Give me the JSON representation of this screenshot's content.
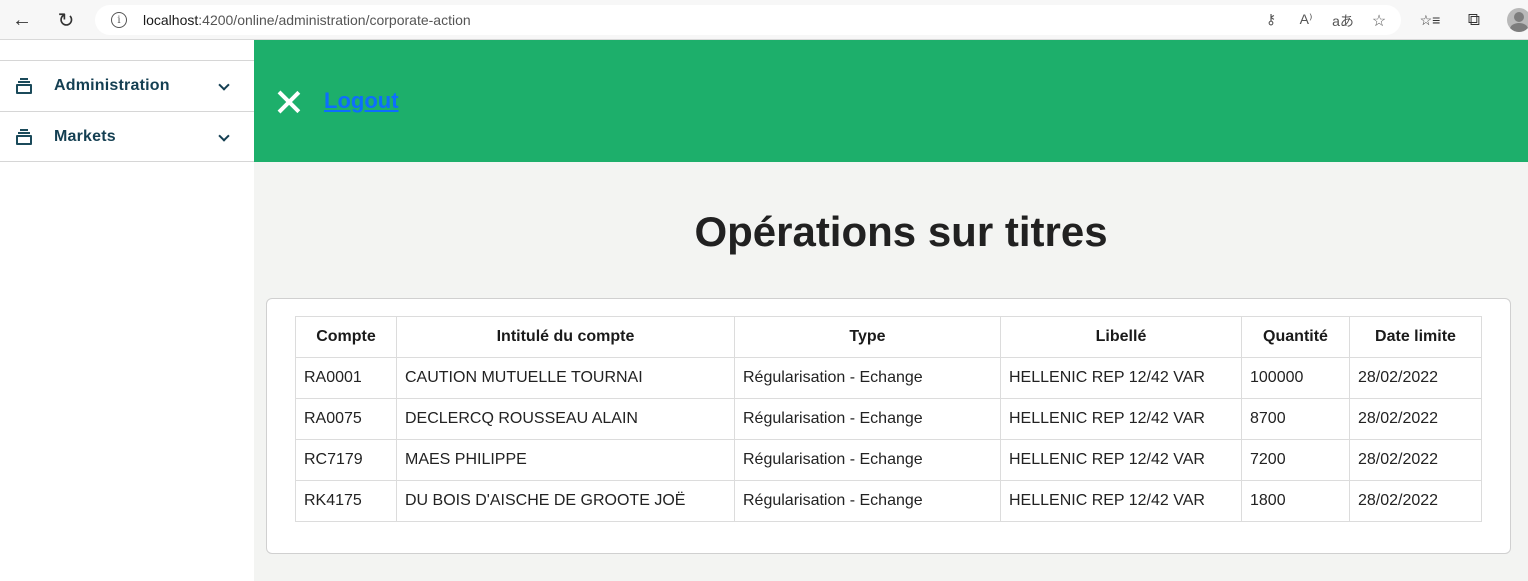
{
  "browser": {
    "url_host": "localhost",
    "url_rest": ":4200/online/administration/corporate-action",
    "icons": [
      "back-icon",
      "refresh-icon",
      "info-icon",
      "key-icon",
      "read-aloud-icon",
      "translate-icon",
      "add-favorite-icon",
      "favorites-icon",
      "collections-icon",
      "profile-icon"
    ],
    "glyphs": {
      "back": "←",
      "refresh": "↻",
      "info": "i",
      "key": "⚷",
      "read_aloud": "A⁾",
      "translate": "aあ",
      "add_favorite": "☆",
      "favorites": "☆≡",
      "collections": "⧉"
    }
  },
  "sidebar": {
    "items": [
      {
        "label": "Administration",
        "icon": "inbox-stack-icon"
      },
      {
        "label": "Markets",
        "icon": "inbox-stack-icon"
      }
    ]
  },
  "header": {
    "close_icon": "close-icon",
    "logout_label": "Logout",
    "color": "#1daf6b"
  },
  "main": {
    "title": "Opérations sur titres",
    "table": {
      "columns": [
        "Compte",
        "Intitulé du compte",
        "Type",
        "Libellé",
        "Quantité",
        "Date limite"
      ],
      "rows": [
        [
          "RA0001",
          "CAUTION MUTUELLE TOURNAI",
          "Régularisation - Echange",
          "HELLENIC REP 12/42 VAR",
          "100000",
          "28/02/2022"
        ],
        [
          "RA0075",
          "DECLERCQ ROUSSEAU ALAIN",
          "Régularisation - Echange",
          "HELLENIC REP 12/42 VAR",
          "8700",
          "28/02/2022"
        ],
        [
          "RC7179",
          "MAES PHILIPPE",
          "Régularisation - Echange",
          "HELLENIC REP 12/42 VAR",
          "7200",
          "28/02/2022"
        ],
        [
          "RK4175",
          "DU BOIS D'AISCHE DE GROOTE JOË",
          "Régularisation - Echange",
          "HELLENIC REP 12/42 VAR",
          "1800",
          "28/02/2022"
        ]
      ]
    }
  }
}
